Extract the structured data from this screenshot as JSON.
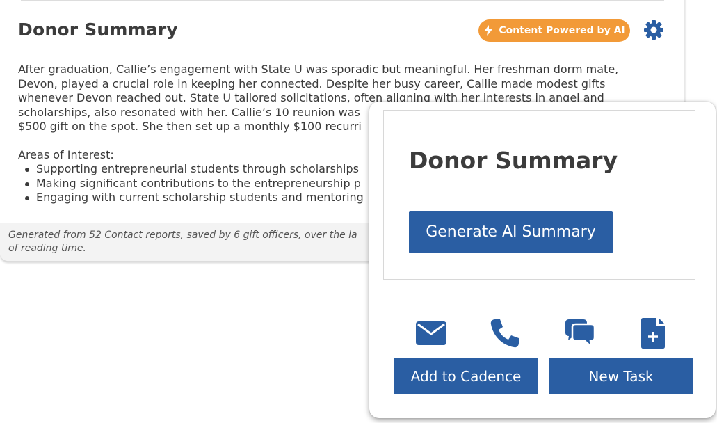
{
  "summary": {
    "title": "Donor Summary",
    "ai_badge": "Content Powered by AI",
    "paragraph_lines": [
      "After graduation, Callie’s engagement with State U was sporadic but meaningful. Her freshman dorm mate,",
      "Devon, played a crucial role in keeping her connected. Despite her busy career, Callie made modest gifts",
      "whenever Devon reached out. State U tailored solicitations, often aligning with her interests in angel and",
      "scholarships, also resonated with her. Callie’s 10 reunion was",
      "$500 gift on the spot. She then set up a monthly $100 recurri"
    ],
    "areas_heading": "Areas of Interest:",
    "areas": [
      "Supporting entrepreneurial students through scholarships",
      "Making significant contributions to the entrepreneurship p",
      "Engaging with current scholarship students and mentoring"
    ],
    "footer_lines": [
      "Generated from 52 Contact reports, saved by 6 gift officers, over the la",
      "of reading time."
    ]
  },
  "panel": {
    "title": "Donor Summary",
    "generate_label": "Generate AI Summary",
    "icons": [
      "envelope-icon",
      "phone-icon",
      "chat-icon",
      "file-plus-icon"
    ],
    "add_cadence_label": "Add to Cadence",
    "new_task_label": "New Task"
  },
  "colors": {
    "primary": "#2a5ea3",
    "badge": "#f29a38",
    "text": "#3a3a3a"
  }
}
